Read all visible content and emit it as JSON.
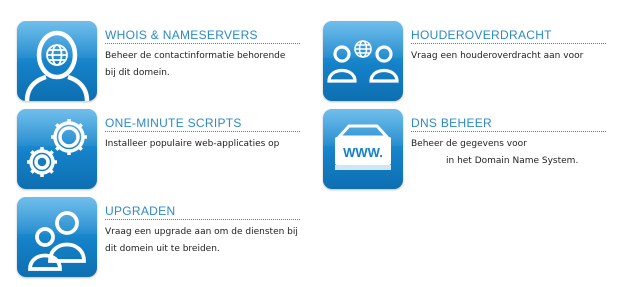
{
  "tiles": [
    {
      "title": "WHOIS & NAMESERVERS",
      "lines": [
        "Beheer de contactinformatie behorende",
        "bij dit domein."
      ],
      "icon": "globe-user-icon"
    },
    {
      "title": "HOUDEROVERDRACHT",
      "lines": [
        "Vraag een houderoverdracht aan voor"
      ],
      "icon": "users-globe-icon"
    },
    {
      "title": "ONE-MINUTE SCRIPTS",
      "lines": [
        "Installeer populaire web-applicaties op"
      ],
      "icon": "gears-icon"
    },
    {
      "title": "DNS BEHEER",
      "lines": [
        "Beheer de gegevens voor",
        "in het Domain Name System."
      ],
      "icon": "www-server-icon"
    },
    {
      "title": "UPGRADEN",
      "lines": [
        "Vraag een upgrade aan om de diensten bij",
        "dit domein uit te breiden."
      ],
      "icon": "users-icon"
    }
  ]
}
